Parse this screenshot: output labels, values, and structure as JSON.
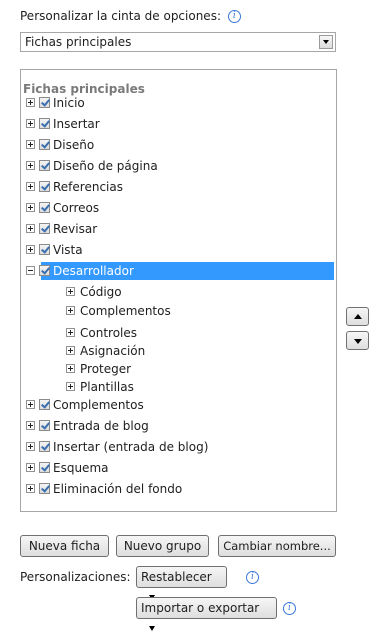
{
  "header": {
    "label": "Personalizar la cinta de opciones:",
    "info_icon": "info-icon",
    "select_value": "Fichas principales"
  },
  "tree": {
    "header": "Fichas principales",
    "items": [
      {
        "label": "Inicio",
        "expanded": false,
        "checked": true
      },
      {
        "label": "Insertar",
        "expanded": false,
        "checked": true
      },
      {
        "label": "Diseño",
        "expanded": false,
        "checked": true
      },
      {
        "label": "Diseño de página",
        "expanded": false,
        "checked": true
      },
      {
        "label": "Referencias",
        "expanded": false,
        "checked": true
      },
      {
        "label": "Correos",
        "expanded": false,
        "checked": true
      },
      {
        "label": "Revisar",
        "expanded": false,
        "checked": true
      },
      {
        "label": "Vista",
        "expanded": false,
        "checked": true
      },
      {
        "label": "Desarrollador",
        "expanded": true,
        "checked": true,
        "selected": true
      },
      {
        "label": "Complementos",
        "expanded": false,
        "checked": true
      },
      {
        "label": "Entrada de blog",
        "expanded": false,
        "checked": true
      },
      {
        "label": "Insertar (entrada de blog)",
        "expanded": false,
        "checked": true
      },
      {
        "label": "Esquema",
        "expanded": false,
        "checked": true
      },
      {
        "label": "Eliminación del fondo",
        "expanded": false,
        "checked": true
      }
    ],
    "groups": [
      {
        "label": "Código"
      },
      {
        "label": "Complementos"
      },
      {
        "label": "Controles"
      },
      {
        "label": "Asignación"
      },
      {
        "label": "Proteger"
      },
      {
        "label": "Plantillas"
      }
    ]
  },
  "buttons": {
    "new_tab": "Nueva ficha",
    "new_group": "Nuevo grupo",
    "rename": "Cambiar nombre..."
  },
  "customizations": {
    "label": "Personalizaciones:",
    "reset": "Restablecer",
    "import_export": "Importar o exportar"
  },
  "colors": {
    "selection": "#3399ff",
    "info": "#3b78d8"
  }
}
